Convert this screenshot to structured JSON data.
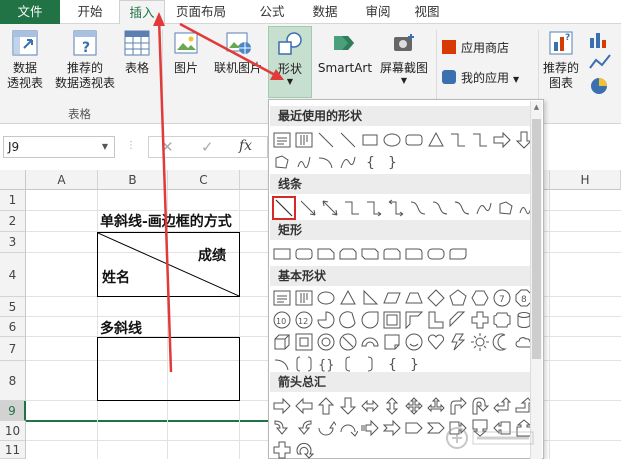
{
  "tabs": [
    {
      "label": "文件",
      "active": false
    },
    {
      "label": "开始",
      "active": false
    },
    {
      "label": "插入",
      "active": true
    },
    {
      "label": "页面布局",
      "active": false
    },
    {
      "label": "公式",
      "active": false
    },
    {
      "label": "数据",
      "active": false
    },
    {
      "label": "审阅",
      "active": false
    },
    {
      "label": "视图",
      "active": false
    }
  ],
  "ribbon": {
    "pivot_line1": "数据",
    "pivot_line2": "透视表",
    "rec_pivot_line1": "推荐的",
    "rec_pivot_line2": "数据透视表",
    "table": "表格",
    "group_tables": "表格",
    "picture": "图片",
    "online_picture": "联机图片",
    "shapes": "形状",
    "smartart": "SmartArt",
    "screenshot": "屏幕截图",
    "app_store": "应用商店",
    "my_apps": "我的应用",
    "rec_charts_line1": "推荐的",
    "rec_charts_line2": "图表"
  },
  "formula_bar": {
    "name_box": "J9",
    "fx": "fx"
  },
  "grid": {
    "columns": [
      "A",
      "B",
      "C",
      "H"
    ],
    "rows": [
      "1",
      "2",
      "3",
      "4",
      "5",
      "6",
      "7",
      "8",
      "9",
      "10",
      "11"
    ],
    "selected_row": "9",
    "title_single": "单斜线-画边框的方式",
    "header_score": "成绩",
    "header_name": "姓名",
    "title_multi": "多斜线"
  },
  "shapes_menu": {
    "recent": "最近使用的形状",
    "lines": "线条",
    "rect": "矩形",
    "basic": "基本形状",
    "arrows": "箭头总汇"
  },
  "colors": {
    "accent": "#217346",
    "annotation": "#e03a3a"
  }
}
